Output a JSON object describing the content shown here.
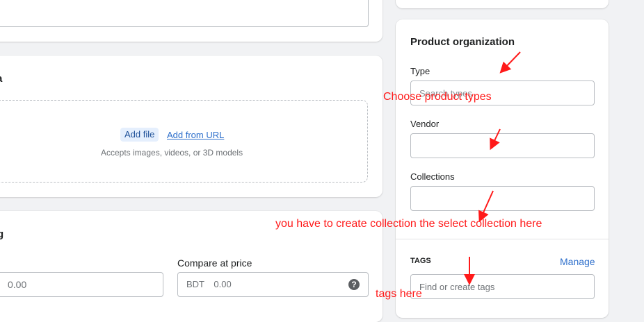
{
  "description_card": {},
  "media": {
    "title_fragment": "a",
    "add_file_label": "Add file",
    "add_url_label": "Add from URL",
    "accepts_text": "Accepts images, videos, or 3D models"
  },
  "pricing": {
    "title_fragment": "g",
    "price_value": "0.00",
    "compare_label": "Compare at price",
    "compare_prefix": "BDT",
    "compare_value": "0.00"
  },
  "org": {
    "title": "Product organization",
    "type_label": "Type",
    "type_placeholder": "Search types",
    "vendor_label": "Vendor",
    "collections_label": "Collections",
    "tags_label": "TAGS",
    "manage_label": "Manage",
    "tags_placeholder": "Find or create tags"
  },
  "annotations": {
    "types_note": "Choose product types",
    "collection_note": "you have to create collection the select collection here",
    "tags_note": "tags here",
    "color": "#ff1a1a"
  },
  "icons": {
    "help": "question-circle-icon"
  }
}
